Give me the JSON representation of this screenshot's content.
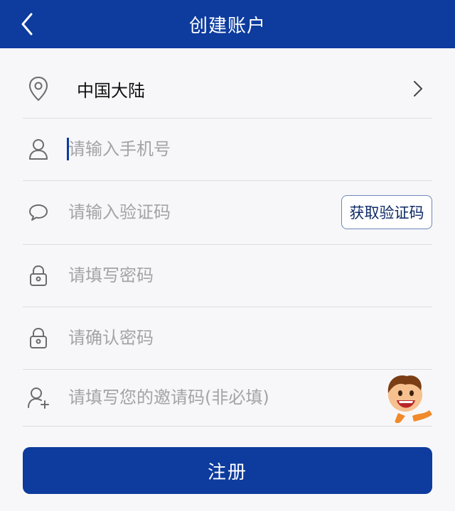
{
  "header": {
    "title": "创建账户",
    "back_icon": "chevron-left-icon",
    "background": "#0d3b9e"
  },
  "form": {
    "region": {
      "icon": "location-pin-icon",
      "value": "中国大陆",
      "action_icon": "chevron-right-icon"
    },
    "phone": {
      "icon": "user-icon",
      "value": "",
      "placeholder": "请输入手机号"
    },
    "verification_code": {
      "icon": "chat-bubble-icon",
      "value": "",
      "placeholder": "请输入验证码",
      "get_code_label": "获取验证码"
    },
    "password": {
      "icon": "lock-icon",
      "value": "",
      "placeholder": "请填写密码"
    },
    "confirm_password": {
      "icon": "lock-icon",
      "value": "",
      "placeholder": "请确认密码"
    },
    "invite_code": {
      "icon": "user-add-icon",
      "value": "",
      "placeholder": "请填写您的邀请码(非必填)"
    }
  },
  "register_button": {
    "label": "注册"
  },
  "colors": {
    "accent": "#0d3b9e",
    "placeholder": "#a3a3a8",
    "divider": "#dcdde2"
  }
}
